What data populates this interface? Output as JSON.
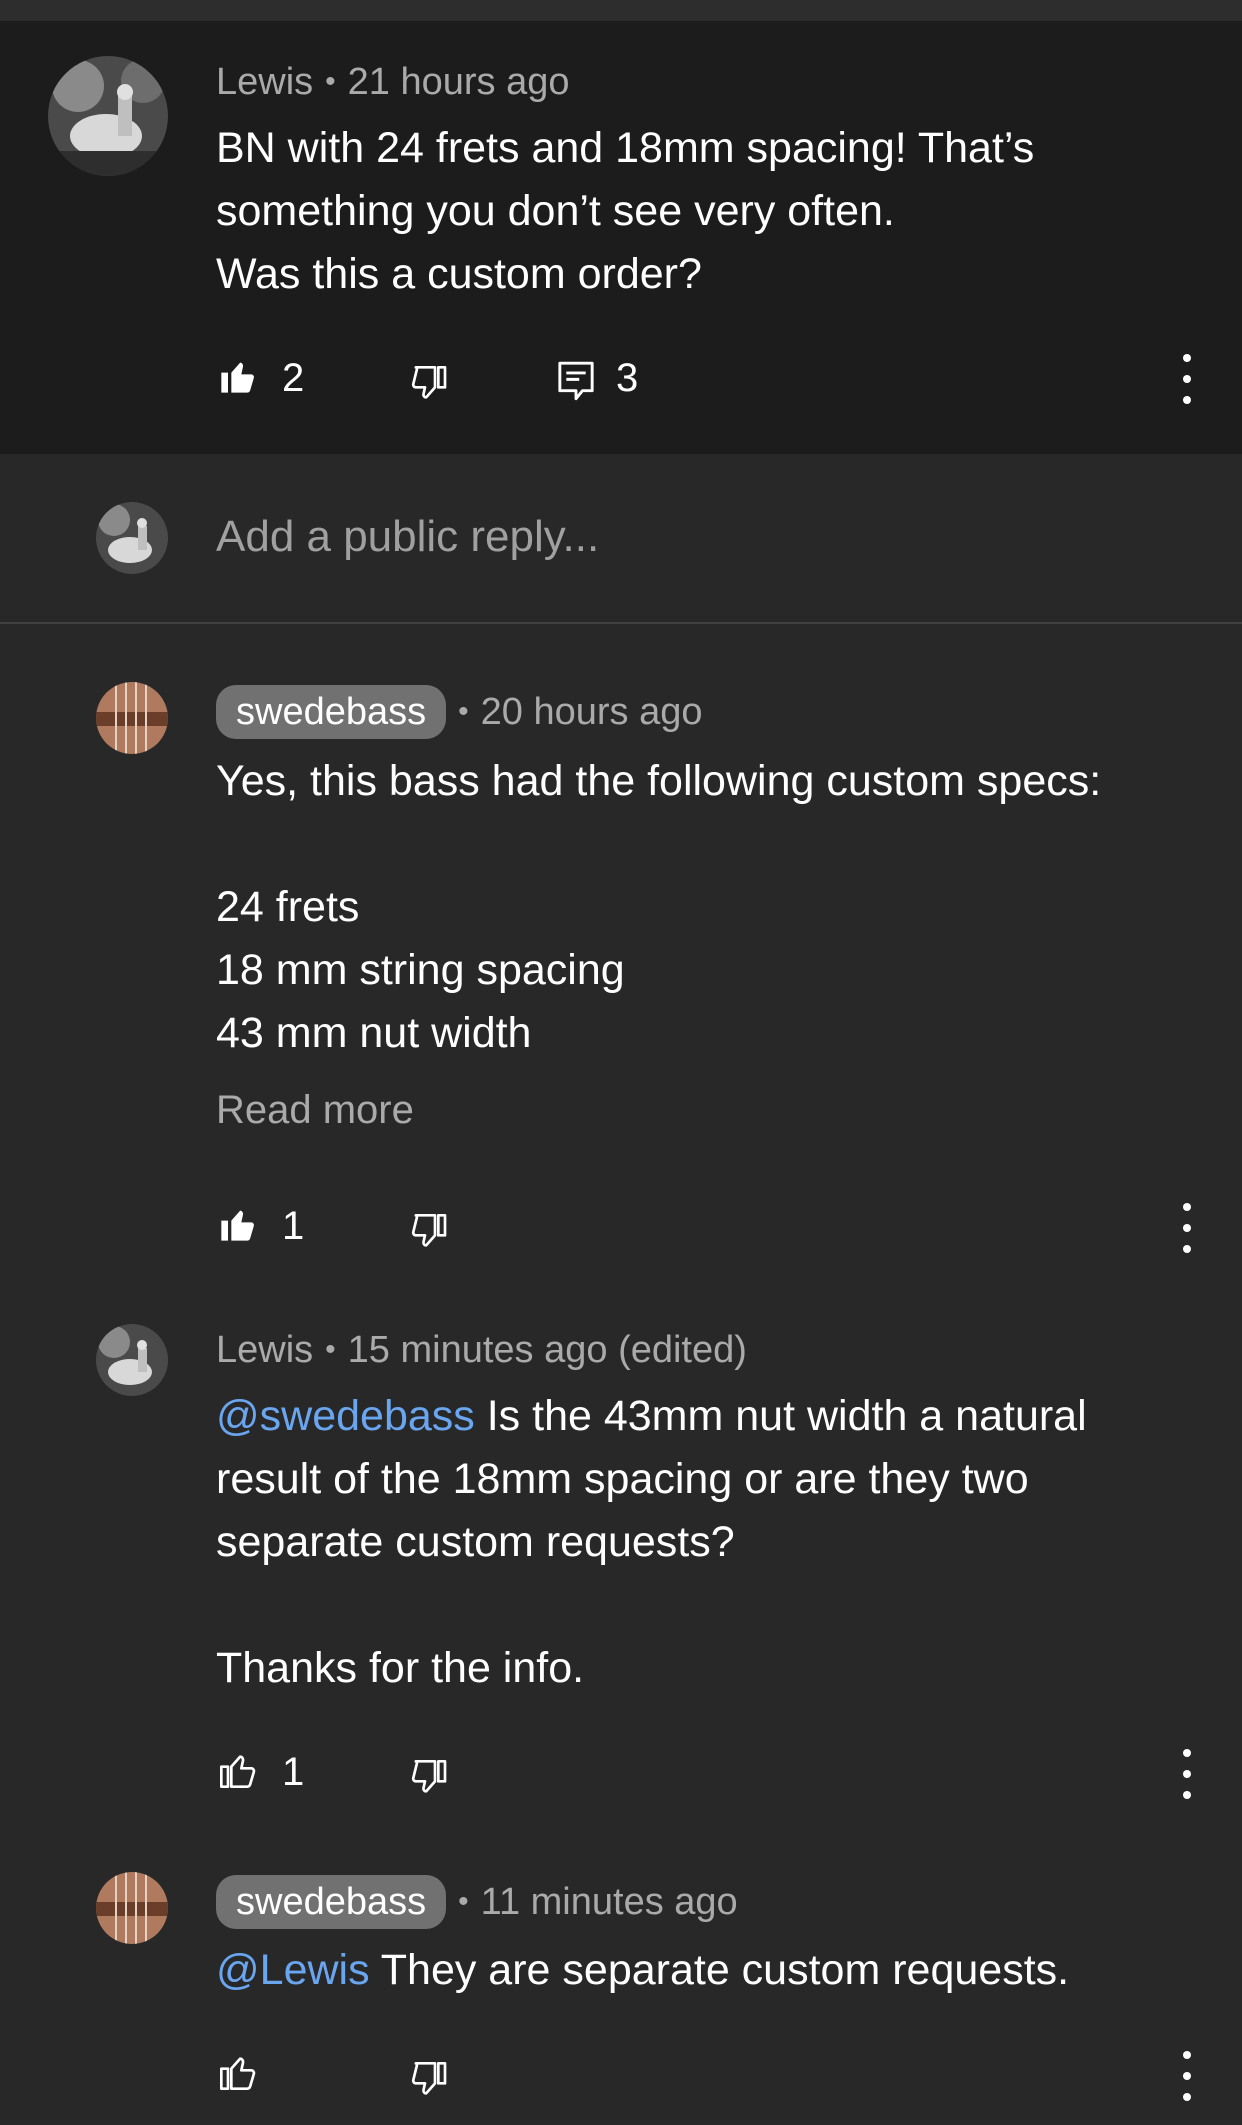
{
  "parent_comment": {
    "author": "Lewis",
    "time": "21 hours ago",
    "text": "BN with 24 frets and 18mm spacing! That’s\nsomething you don’t see very often.\nWas this a custom order?",
    "likes": "2",
    "replies": "3"
  },
  "reply_box": {
    "placeholder": "Add a public reply..."
  },
  "replies": [
    {
      "author": "swedebass",
      "author_is_creator": true,
      "time": "20 hours ago",
      "text": "Yes, this bass had the following custom specs:\n\n24 frets\n18 mm string spacing\n43 mm nut width",
      "read_more": "Read more",
      "likes": "1"
    },
    {
      "author": "Lewis",
      "time": "15 minutes ago (edited)",
      "mention": "@swedebass",
      "text": " Is the 43mm nut width a natural\nresult of the 18mm spacing or are they two\nseparate custom requests?\n\nThanks for the info.",
      "likes": "1"
    },
    {
      "author": "swedebass",
      "author_is_creator": true,
      "time": "11 minutes ago",
      "mention": "@Lewis",
      "text": " They are separate custom requests.",
      "likes": ""
    }
  ],
  "separator": "•",
  "icons": {
    "like": "thumbs-up-icon",
    "dislike": "thumbs-down-icon",
    "reply": "comment-icon",
    "more": "more-vert-icon"
  },
  "colors": {
    "background": "#282828",
    "parent_background": "#1c1c1c",
    "mention": "#6aa5ef",
    "meta_text": "#aaaaaa",
    "creator_chip": "#717171"
  }
}
